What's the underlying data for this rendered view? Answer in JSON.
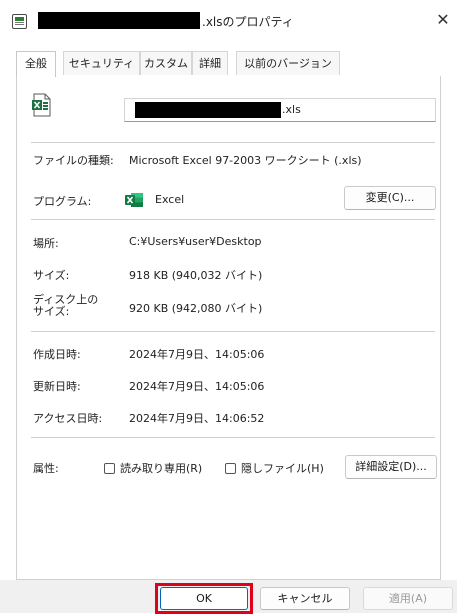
{
  "window": {
    "title_suffix": ".xlsのプロパティ",
    "close_glyph": "✕"
  },
  "tabs": [
    {
      "label": "全般",
      "active": true
    },
    {
      "label": "セキュリティ"
    },
    {
      "label": "カスタム"
    },
    {
      "label": "詳細"
    },
    {
      "label": "以前のバージョン"
    }
  ],
  "file": {
    "icon": "excel-file-icon",
    "name_suffix": ".xls"
  },
  "type": {
    "label": "ファイルの種類:",
    "value": "Microsoft Excel 97-2003 ワークシート (.xls)"
  },
  "program": {
    "label": "プログラム:",
    "icon": "excel-icon",
    "name": "Excel",
    "change_button": "変更(C)..."
  },
  "location": {
    "label": "場所:",
    "value": "C:¥Users¥user¥Desktop"
  },
  "size": {
    "label": "サイズ:",
    "value": "918 KB (940,032 バイト)"
  },
  "disk_size": {
    "label": "ディスク上のサイズ:",
    "value": "920 KB (942,080 バイト)"
  },
  "created": {
    "label": "作成日時:",
    "value": "2024年7月9日、14:05:06"
  },
  "modified": {
    "label": "更新日時:",
    "value": "2024年7月9日、14:05:06"
  },
  "accessed": {
    "label": "アクセス日時:",
    "value": "2024年7月9日、14:06:52"
  },
  "attributes": {
    "label": "属性:",
    "readonly": {
      "label": "読み取り専用(R)",
      "checked": false
    },
    "hidden": {
      "label": "隠しファイル(H)",
      "checked": false
    },
    "advanced_button": "詳細設定(D)..."
  },
  "footer": {
    "ok": "OK",
    "cancel": "キャンセル",
    "apply": "適用(A)",
    "highlight_color": "#e0001b"
  }
}
